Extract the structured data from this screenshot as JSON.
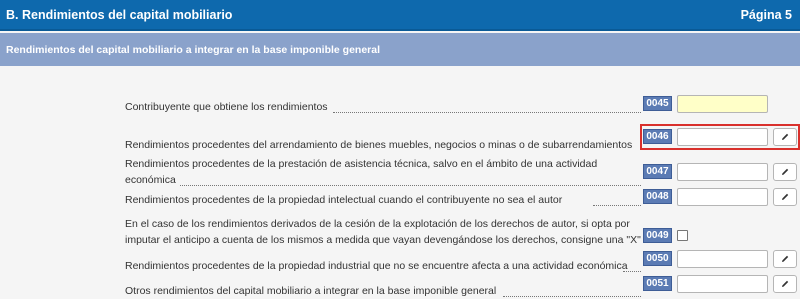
{
  "header": {
    "section_title": "B.  Rendimientos del capital mobiliario",
    "page_label": "Página 5"
  },
  "subheader": {
    "title": "Rendimientos del capital mobiliario a integrar en la base imponible general"
  },
  "rows": [
    {
      "label": "Contribuyente que obtiene los rendimientos",
      "code": "0045",
      "value": "",
      "field_type": "text-yellow"
    },
    {
      "label": "Rendimientos procedentes del arrendamiento de bienes muebles, negocios o minas o de subarrendamientos",
      "code": "0046",
      "value": "",
      "field_type": "text-edit",
      "highlighted": true
    },
    {
      "label_line1": "Rendimientos procedentes de la prestación de asistencia técnica, salvo en el ámbito de una actividad",
      "label_line2": "económica",
      "code": "0047",
      "value": "",
      "field_type": "text-edit"
    },
    {
      "label": "Rendimientos procedentes de la propiedad intelectual cuando el contribuyente no sea el autor",
      "code": "0048",
      "value": "",
      "field_type": "text-edit"
    },
    {
      "label_line1": "En el caso de los rendimientos derivados de la cesión de la explotación de los derechos de autor, si opta por",
      "label_line2": "imputar el anticipo a cuenta de los mismos a medida que vayan devengándose los derechos, consigne una \"X\"",
      "code": "0049",
      "checked": false,
      "field_type": "checkbox"
    },
    {
      "label": "Rendimientos procedentes de la propiedad industrial que no se encuentre afecta a una actividad económica",
      "code": "0050",
      "value": "",
      "field_type": "text-edit"
    },
    {
      "label": "Otros rendimientos del capital mobiliario a integrar en la base imponible general",
      "code": "0051",
      "value": "",
      "field_type": "text-edit"
    }
  ],
  "icons": {
    "edit": "pencil-icon"
  },
  "colors": {
    "header_bg": "#0e69ad",
    "subheader_bg": "#8aa2cb",
    "code_bg": "#5b7bb4",
    "highlight": "#d9302c",
    "yellow_field": "#ffffc8"
  }
}
